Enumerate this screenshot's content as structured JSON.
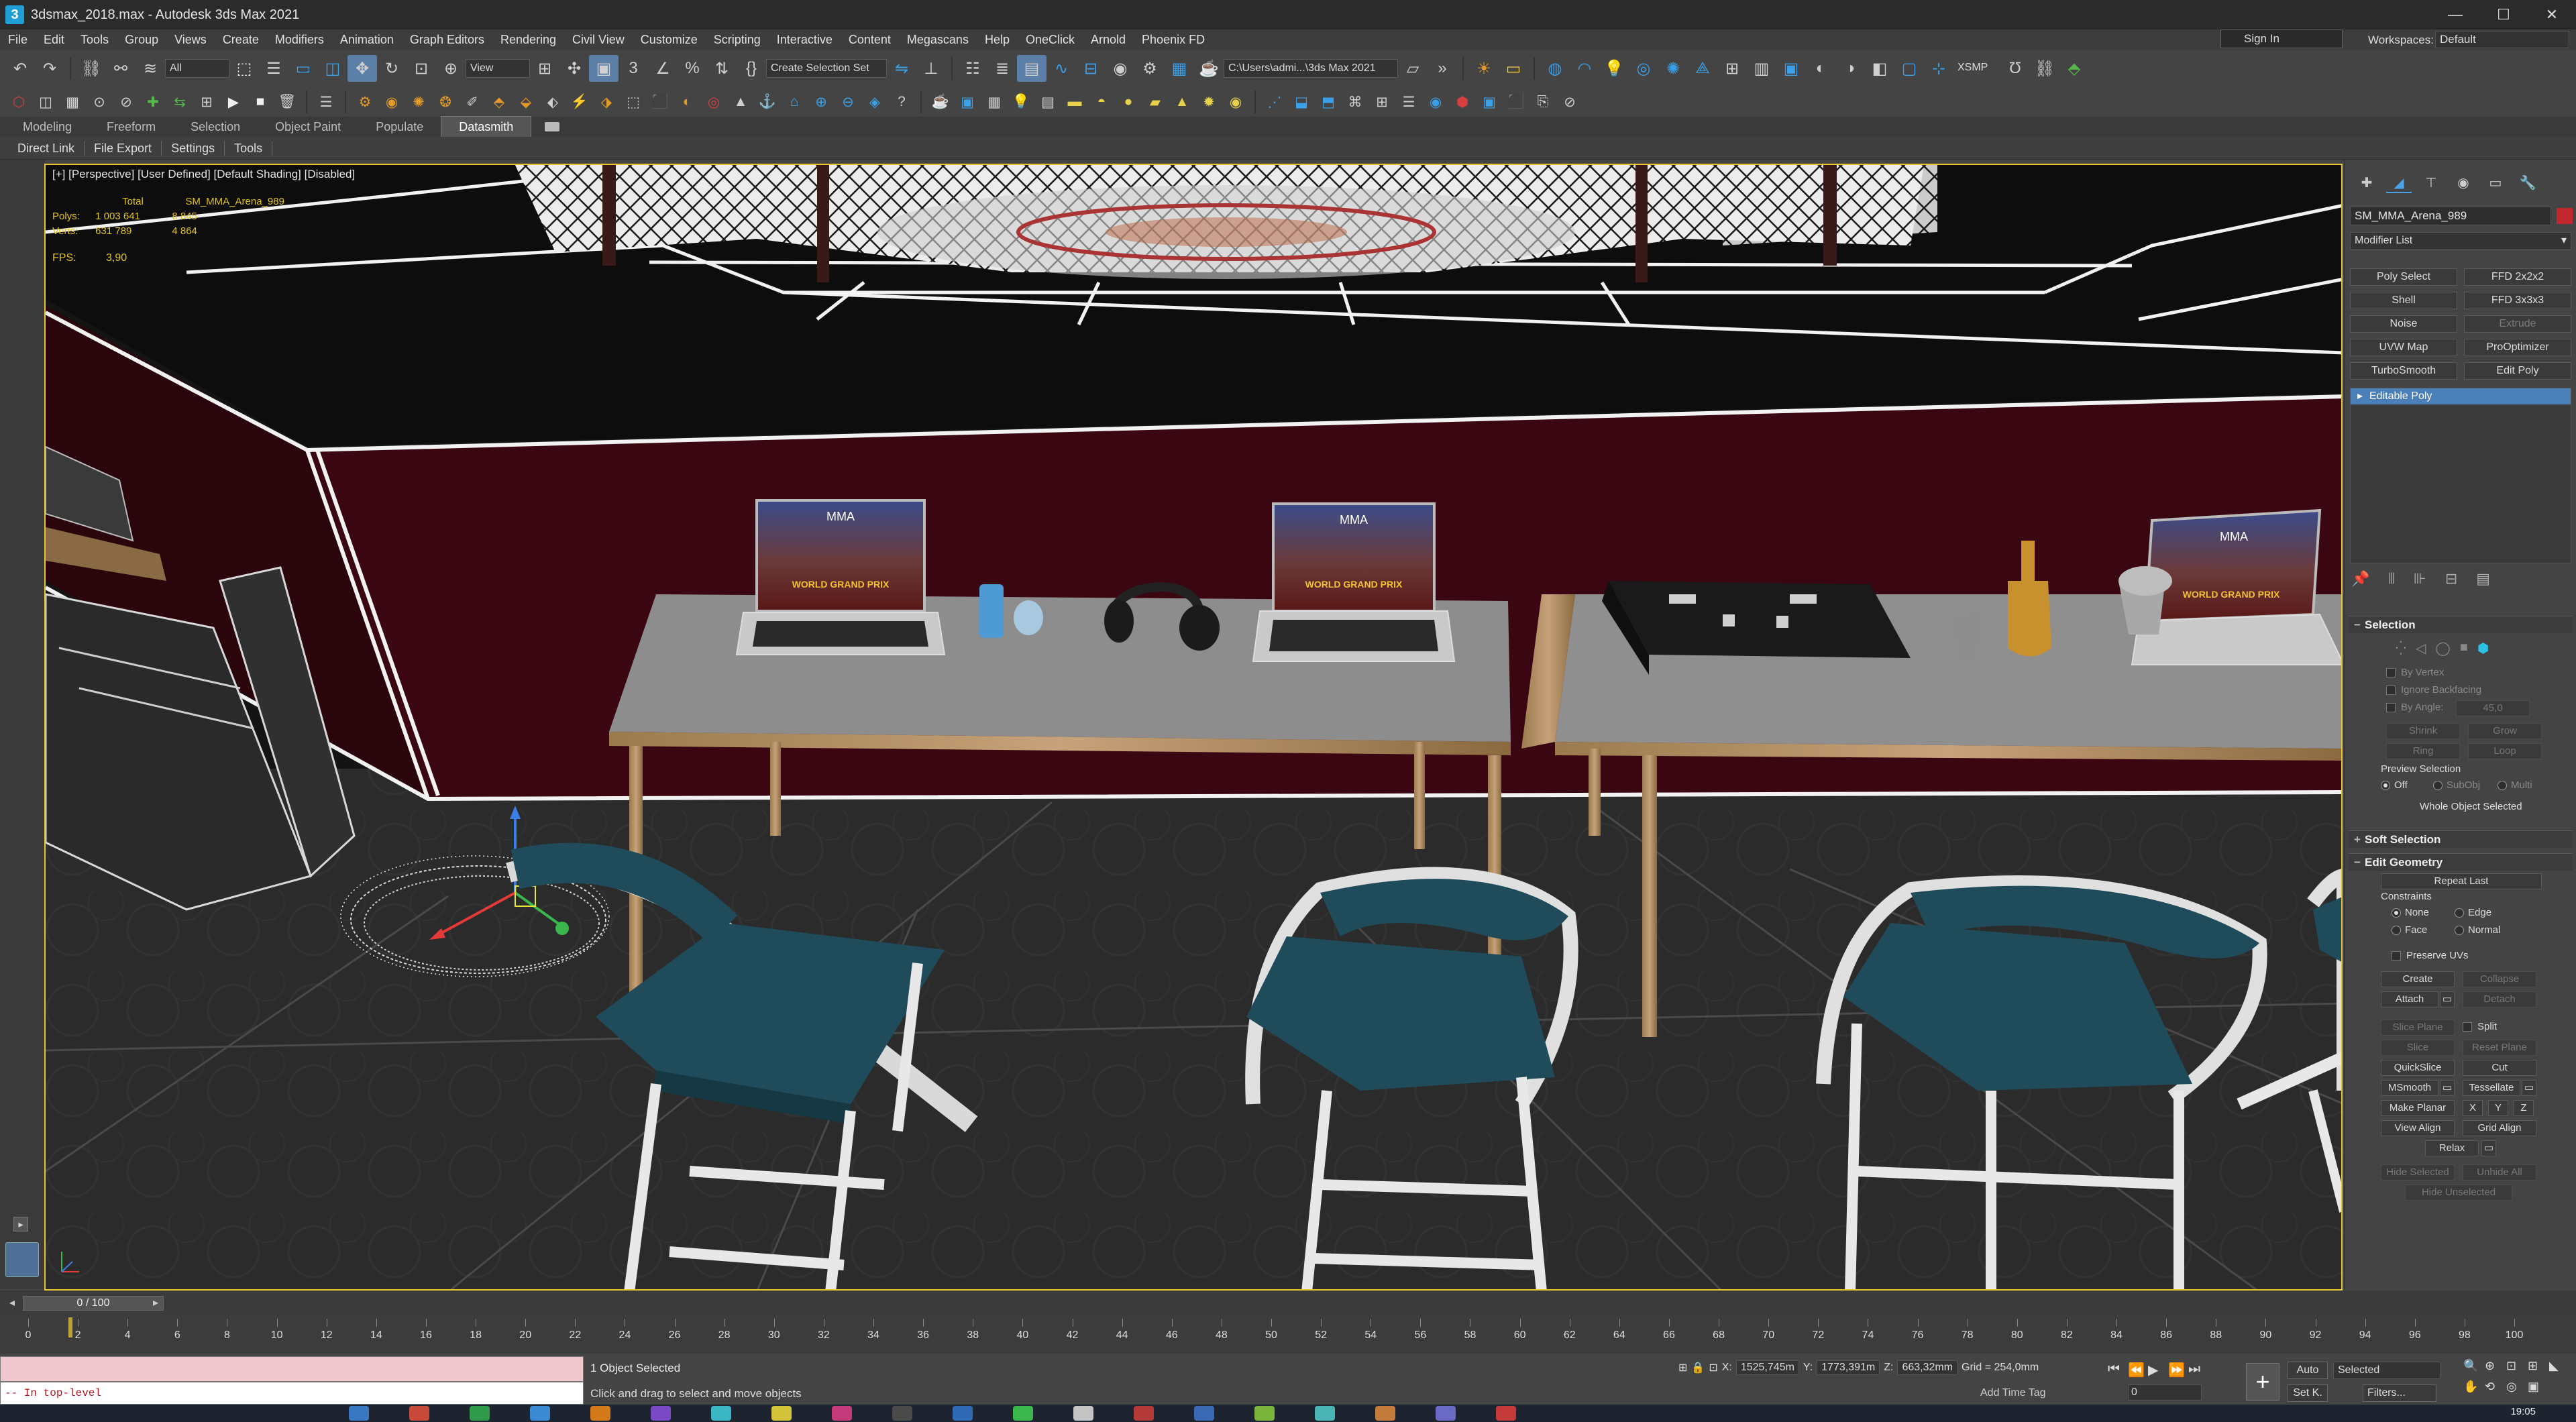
{
  "window": {
    "title": "3dsmax_2018.max - Autodesk 3ds Max 2021",
    "controls": [
      "—",
      "☐",
      "✕"
    ]
  },
  "menu": [
    "File",
    "Edit",
    "Tools",
    "Group",
    "Views",
    "Create",
    "Modifiers",
    "Animation",
    "Graph Editors",
    "Rendering",
    "Civil View",
    "Customize",
    "Scripting",
    "Interactive",
    "Content",
    "Megascans",
    "Help",
    "OneClick",
    "Arnold",
    "Phoenix FD"
  ],
  "account": {
    "signin": "Sign In",
    "workspaces_label": "Workspaces:",
    "workspace_value": "Default"
  },
  "toolbar": {
    "filter_value": "All",
    "refcoord_value": "View",
    "selection_set_placeholder": "Create Selection Set",
    "path_value": "C:\\Users\\admi...\\3ds Max 2021",
    "xsmp": "XSMP"
  },
  "ribbon": {
    "tabs": [
      "Modeling",
      "Freeform",
      "Selection",
      "Object Paint",
      "Populate",
      "Datasmith"
    ],
    "active": "Datasmith",
    "subtabs": [
      "Direct Link",
      "File Export",
      "Settings",
      "Tools"
    ]
  },
  "viewport": {
    "label": "[+] [Perspective] [User Defined] [Default Shading] [Disabled]",
    "stats_header": [
      "Total",
      "SM_MMA_Arena_989"
    ],
    "stats": [
      {
        "name": "Polys:",
        "total": "1 003 641",
        "selected": "8 845"
      },
      {
        "name": "Verts:",
        "total": "631 789",
        "selected": "4 864"
      }
    ],
    "fps_label": "FPS:",
    "fps_value": "3,90",
    "laptop_screen_title": "WORLD GRAND PRIX",
    "laptop_screen_logo": "MMA"
  },
  "command_panel": {
    "tabs": [
      "create-icon",
      "modify-icon",
      "hierarchy-icon",
      "motion-icon",
      "display-icon",
      "utilities-icon"
    ],
    "object_name": "SM_MMA_Arena_989",
    "object_color": "#c0282d",
    "modifier_list": "Modifier List",
    "modifier_buttons": [
      {
        "label": "Poly Select",
        "enabled": true
      },
      {
        "label": "FFD 2x2x2",
        "enabled": true
      },
      {
        "label": "Shell",
        "enabled": true
      },
      {
        "label": "FFD 3x3x3",
        "enabled": true
      },
      {
        "label": "Noise",
        "enabled": true
      },
      {
        "label": "Extrude",
        "enabled": false
      },
      {
        "label": "UVW Map",
        "enabled": true
      },
      {
        "label": "ProOptimizer",
        "enabled": true
      },
      {
        "label": "TurboSmooth",
        "enabled": true
      },
      {
        "label": "Edit Poly",
        "enabled": true
      }
    ],
    "stack_item": "Editable Poly",
    "selection": {
      "title": "Selection",
      "by_vertex": "By Vertex",
      "ignore_backfacing": "Ignore Backfacing",
      "by_angle": "By Angle:",
      "by_angle_value": "45,0",
      "shrink": "Shrink",
      "grow": "Grow",
      "ring": "Ring",
      "loop": "Loop",
      "preview_selection": "Preview Selection",
      "preview_off": "Off",
      "preview_subobj": "SubObj",
      "preview_multi": "Multi",
      "whole_object": "Whole Object Selected"
    },
    "soft_selection": "Soft Selection",
    "edit_geometry": {
      "title": "Edit Geometry",
      "repeat_last": "Repeat Last",
      "constraints": "Constraints",
      "none": "None",
      "edge": "Edge",
      "face": "Face",
      "normal": "Normal",
      "preserve_uvs": "Preserve UVs",
      "create": "Create",
      "collapse": "Collapse",
      "attach": "Attach",
      "detach": "Detach",
      "slice_plane": "Slice Plane",
      "split": "Split",
      "slice": "Slice",
      "reset_plane": "Reset Plane",
      "quickslice": "QuickSlice",
      "cut": "Cut",
      "msmooth": "MSmooth",
      "tessellate": "Tessellate",
      "make_planar": "Make Planar",
      "x": "X",
      "y": "Y",
      "z": "Z",
      "view_align": "View Align",
      "grid_align": "Grid Align",
      "relax": "Relax",
      "hide_selected": "Hide Selected",
      "unhide_all": "Unhide All",
      "hide_unselected": "Hide Unselected"
    }
  },
  "timeline": {
    "frame_counter": "0 / 100",
    "ticks": [
      "0",
      "2",
      "4",
      "6",
      "8",
      "10",
      "12",
      "14",
      "16",
      "18",
      "20",
      "22",
      "24",
      "26",
      "28",
      "30",
      "32",
      "34",
      "36",
      "38",
      "40",
      "42",
      "44",
      "46",
      "48",
      "50",
      "52",
      "54",
      "56",
      "58",
      "60",
      "62",
      "64",
      "66",
      "68",
      "70",
      "72",
      "74",
      "76",
      "78",
      "80",
      "82",
      "84",
      "86",
      "88",
      "90",
      "92",
      "94",
      "96",
      "98",
      "100"
    ]
  },
  "status": {
    "maxscript_output": "-- In top-level",
    "selected": "1 Object Selected",
    "prompt": "Click and drag to select and move objects",
    "x": "1525,745m",
    "y": "1773,391m",
    "z": "663,32mm",
    "grid": "Grid = 254,0mm",
    "add_time_tag": "Add Time Tag",
    "auto": "Auto",
    "set_key": "Set K.",
    "selected_dropdown": "Selected",
    "filters": "Filters...",
    "frame": "0"
  },
  "taskbar": {
    "clock": "19:05"
  }
}
